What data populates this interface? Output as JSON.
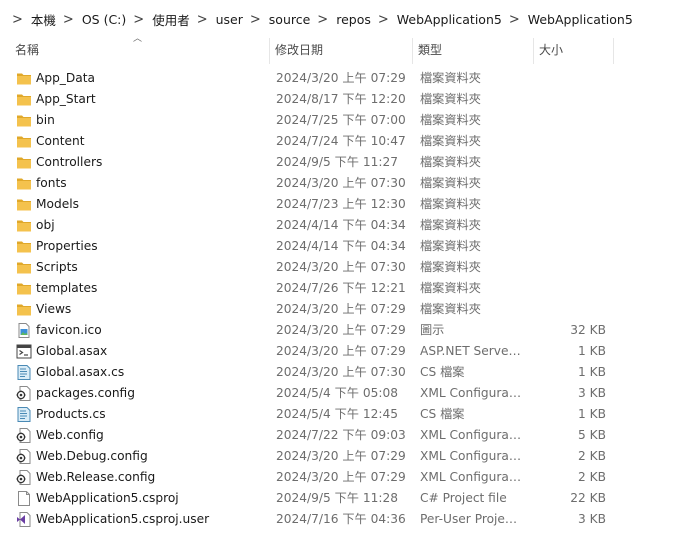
{
  "breadcrumb": [
    "本機",
    "OS (C:)",
    "使用者",
    "user",
    "source",
    "repos",
    "WebApplication5",
    "WebApplication5"
  ],
  "columns": {
    "name": "名稱",
    "date": "修改日期",
    "type": "類型",
    "size": "大小"
  },
  "colors": {
    "folder": "#F4C24D",
    "folder_dark": "#E0A82A",
    "vs_purple": "#6A3EA3",
    "text_secondary": "#6d6d6d"
  },
  "files": [
    {
      "name": "App_Data",
      "date": "2024/3/20 上午 07:29",
      "type": "檔案資料夾",
      "size": "",
      "icon": "folder-icon"
    },
    {
      "name": "App_Start",
      "date": "2024/8/17 下午 12:20",
      "type": "檔案資料夾",
      "size": "",
      "icon": "folder-icon"
    },
    {
      "name": "bin",
      "date": "2024/7/25 下午 07:00",
      "type": "檔案資料夾",
      "size": "",
      "icon": "folder-icon"
    },
    {
      "name": "Content",
      "date": "2024/7/24 下午 10:47",
      "type": "檔案資料夾",
      "size": "",
      "icon": "folder-icon"
    },
    {
      "name": "Controllers",
      "date": "2024/9/5 下午 11:27",
      "type": "檔案資料夾",
      "size": "",
      "icon": "folder-icon"
    },
    {
      "name": "fonts",
      "date": "2024/3/20 上午 07:30",
      "type": "檔案資料夾",
      "size": "",
      "icon": "folder-icon"
    },
    {
      "name": "Models",
      "date": "2024/7/23 上午 12:30",
      "type": "檔案資料夾",
      "size": "",
      "icon": "folder-icon"
    },
    {
      "name": "obj",
      "date": "2024/4/14 下午 04:34",
      "type": "檔案資料夾",
      "size": "",
      "icon": "folder-icon"
    },
    {
      "name": "Properties",
      "date": "2024/4/14 下午 04:34",
      "type": "檔案資料夾",
      "size": "",
      "icon": "folder-icon"
    },
    {
      "name": "Scripts",
      "date": "2024/3/20 上午 07:30",
      "type": "檔案資料夾",
      "size": "",
      "icon": "folder-icon"
    },
    {
      "name": "templates",
      "date": "2024/7/26 下午 12:21",
      "type": "檔案資料夾",
      "size": "",
      "icon": "folder-icon"
    },
    {
      "name": "Views",
      "date": "2024/3/20 上午 07:29",
      "type": "檔案資料夾",
      "size": "",
      "icon": "folder-icon"
    },
    {
      "name": "favicon.ico",
      "date": "2024/3/20 上午 07:29",
      "type": "圖示",
      "size": "32 KB",
      "icon": "image-file-icon"
    },
    {
      "name": "Global.asax",
      "date": "2024/3/20 上午 07:29",
      "type": "ASP.NET Server ...",
      "size": "1 KB",
      "icon": "aspnet-server-file-icon"
    },
    {
      "name": "Global.asax.cs",
      "date": "2024/3/20 上午 07:30",
      "type": "CS 檔案",
      "size": "1 KB",
      "icon": "cs-file-icon"
    },
    {
      "name": "packages.config",
      "date": "2024/5/4 下午 05:08",
      "type": "XML Configurati...",
      "size": "3 KB",
      "icon": "config-file-icon"
    },
    {
      "name": "Products.cs",
      "date": "2024/5/4 下午 12:45",
      "type": "CS 檔案",
      "size": "1 KB",
      "icon": "cs-file-icon"
    },
    {
      "name": "Web.config",
      "date": "2024/7/22 下午 09:03",
      "type": "XML Configurati...",
      "size": "5 KB",
      "icon": "config-file-icon"
    },
    {
      "name": "Web.Debug.config",
      "date": "2024/3/20 上午 07:29",
      "type": "XML Configurati...",
      "size": "2 KB",
      "icon": "config-file-icon"
    },
    {
      "name": "Web.Release.config",
      "date": "2024/3/20 上午 07:29",
      "type": "XML Configurati...",
      "size": "2 KB",
      "icon": "config-file-icon"
    },
    {
      "name": "WebApplication5.csproj",
      "date": "2024/9/5 下午 11:28",
      "type": "C# Project file",
      "size": "22 KB",
      "icon": "csproj-file-icon"
    },
    {
      "name": "WebApplication5.csproj.user",
      "date": "2024/7/16 下午 04:36",
      "type": "Per-User Project ...",
      "size": "3 KB",
      "icon": "vs-user-file-icon"
    }
  ]
}
